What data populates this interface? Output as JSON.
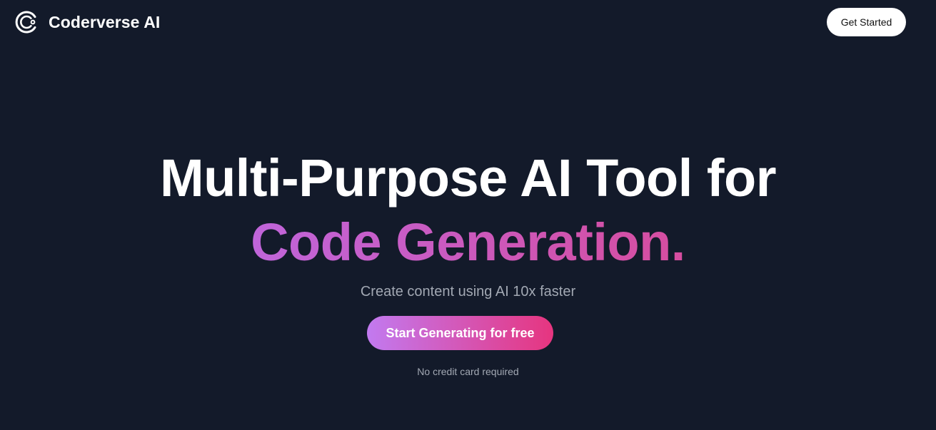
{
  "header": {
    "brand_name": "Coderverse AI",
    "logo_icon": "concentric-c-logo-icon",
    "get_started_label": "Get Started"
  },
  "hero": {
    "headline_line_1": "Multi-Purpose AI Tool for",
    "headline_line_2": "Code Generation.",
    "subtitle": "Create content using AI 10x faster",
    "cta_label": "Start Generating for free",
    "note": "No credit card required"
  },
  "colors": {
    "background": "#131a2a",
    "text_primary": "#ffffff",
    "text_muted": "#a2a8b3",
    "headline_gradient_start": "#c065da",
    "headline_gradient_end": "#d64d9f",
    "cta_gradient_start": "#c27af0",
    "cta_gradient_end": "#e6357f",
    "header_button_bg": "#ffffff",
    "header_button_text": "#111111"
  }
}
